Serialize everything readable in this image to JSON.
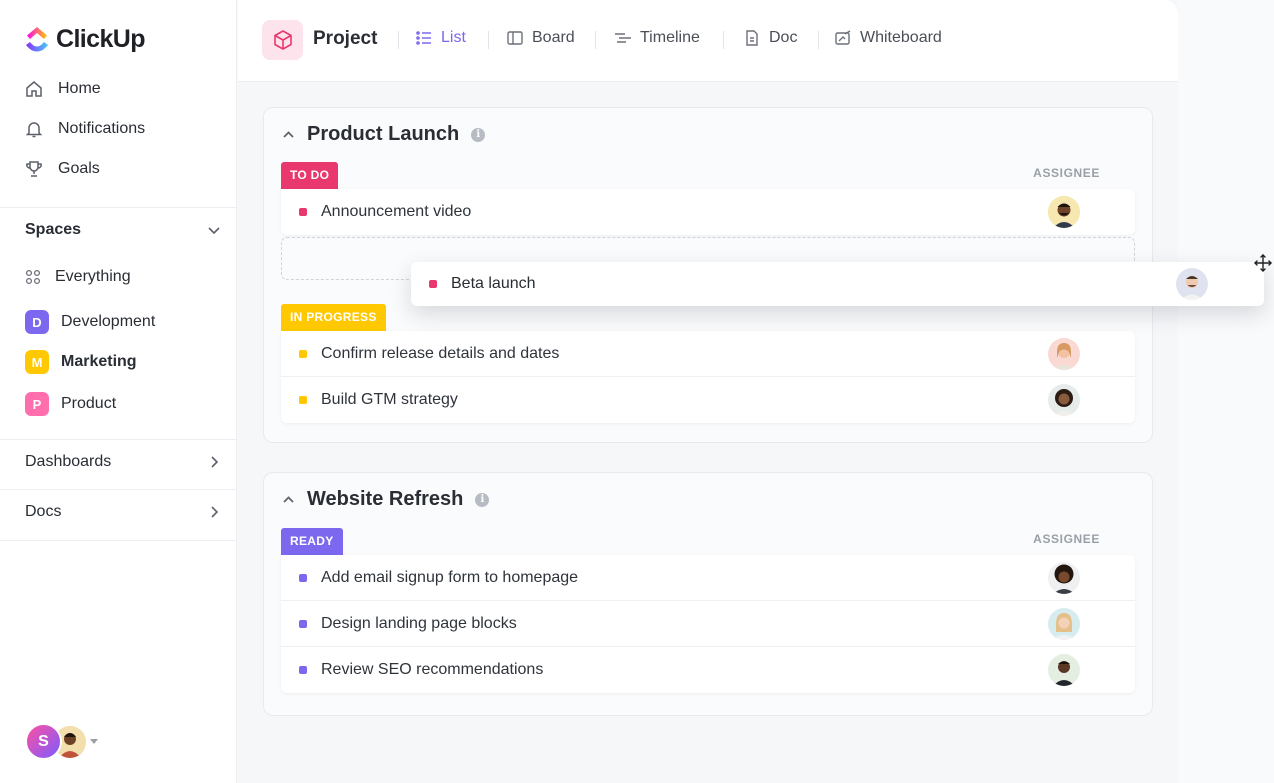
{
  "brand": {
    "name": "ClickUp"
  },
  "sidebar": {
    "nav": [
      {
        "label": "Home",
        "icon": "home-icon"
      },
      {
        "label": "Notifications",
        "icon": "bell-icon"
      },
      {
        "label": "Goals",
        "icon": "trophy-icon"
      }
    ],
    "spaces_label": "Spaces",
    "everything_label": "Everything",
    "spaces": [
      {
        "badge": "D",
        "label": "Development",
        "color": "#7b68ee"
      },
      {
        "badge": "M",
        "label": "Marketing",
        "color": "#ffc800"
      },
      {
        "badge": "P",
        "label": "Product",
        "color": "#ff6fae"
      }
    ],
    "dashboards_label": "Dashboards",
    "docs_label": "Docs",
    "user_initial": "S"
  },
  "topbar": {
    "project_title": "Project",
    "tabs": [
      {
        "label": "List",
        "active": true
      },
      {
        "label": "Board"
      },
      {
        "label": "Timeline"
      },
      {
        "label": "Doc"
      },
      {
        "label": "Whiteboard"
      }
    ]
  },
  "groups": [
    {
      "title": "Product Launch",
      "assignee_label": "ASSIGNEE",
      "statuses": [
        {
          "label": "TO DO",
          "color": "#e8386d",
          "tasks": [
            {
              "name": "Announcement video"
            }
          ]
        },
        {
          "label": "IN PROGRESS",
          "color": "#ffc800",
          "tasks": [
            {
              "name": "Confirm release details and dates"
            },
            {
              "name": "Build GTM strategy"
            }
          ]
        }
      ]
    },
    {
      "title": "Website Refresh",
      "assignee_label": "ASSIGNEE",
      "statuses": [
        {
          "label": "READY",
          "color": "#7b68ee",
          "tasks": [
            {
              "name": "Add email signup form to homepage"
            },
            {
              "name": "Design landing page blocks"
            },
            {
              "name": "Review SEO recommendations"
            }
          ]
        }
      ]
    }
  ],
  "dragging_task": {
    "name": "Beta launch",
    "color": "#e8386d"
  }
}
